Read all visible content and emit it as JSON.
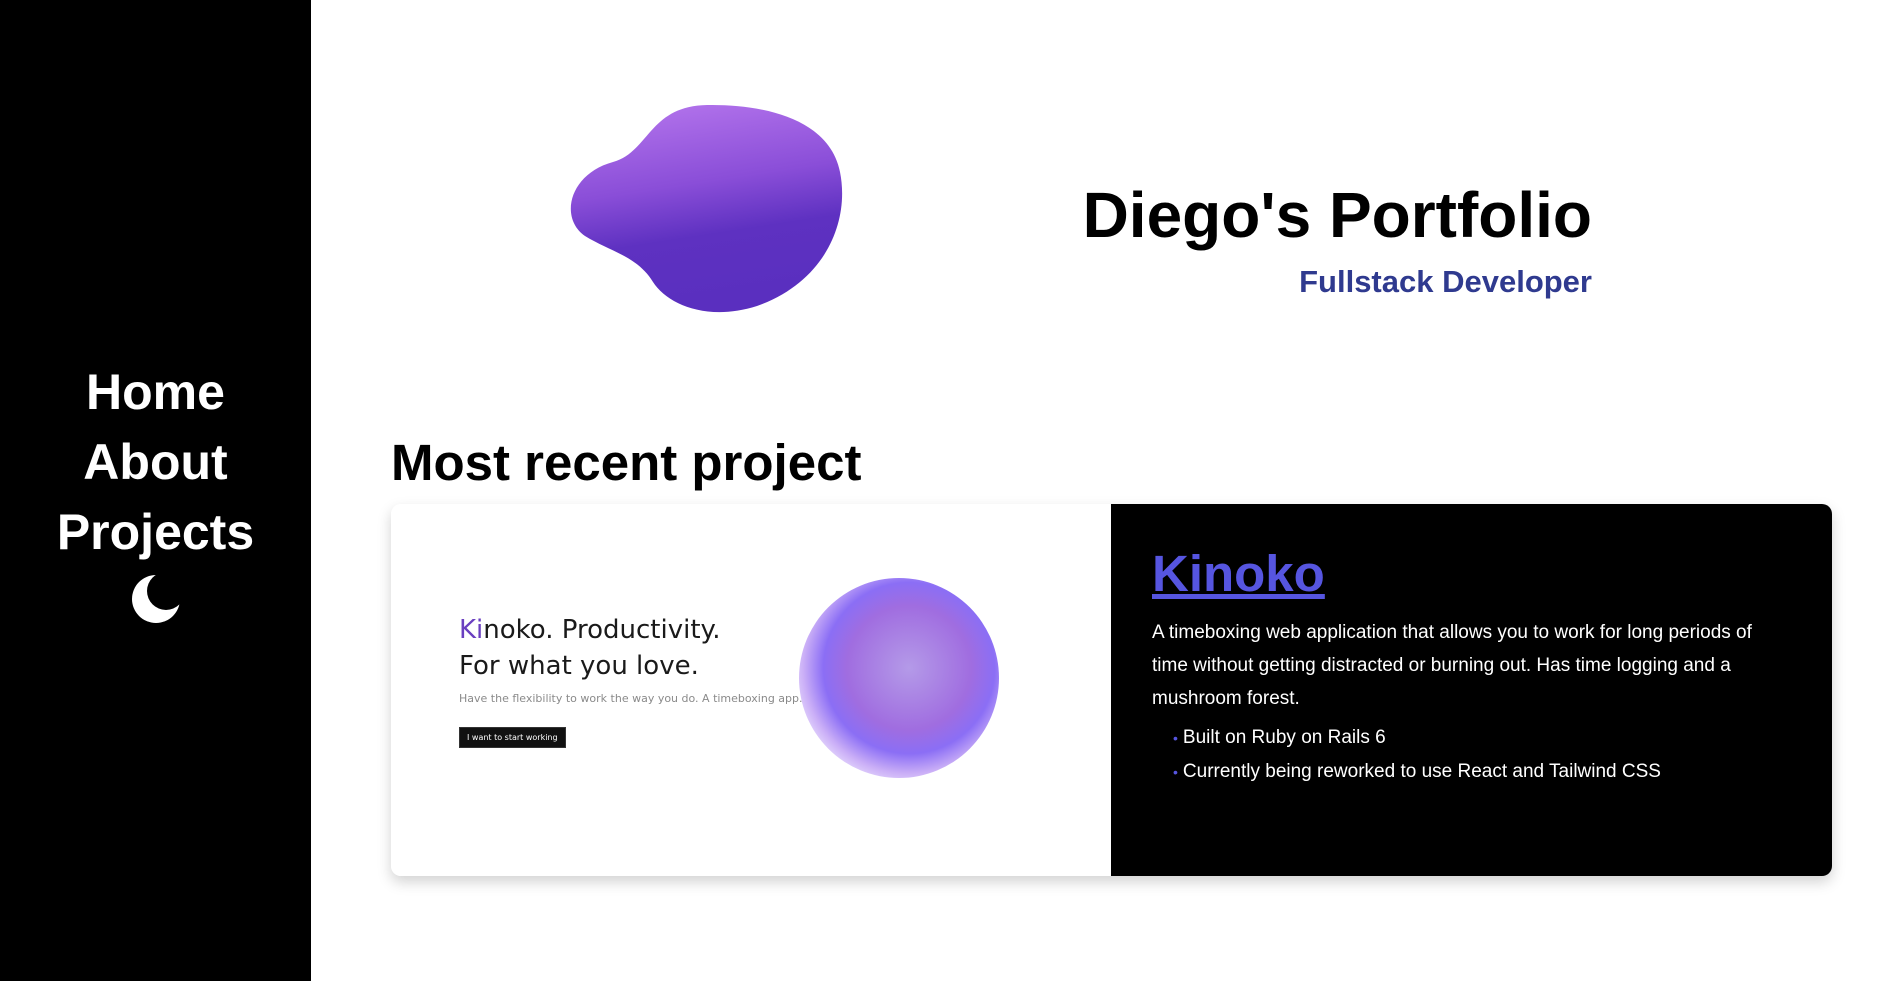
{
  "sidebar": {
    "items": [
      {
        "label": "Home"
      },
      {
        "label": "About"
      },
      {
        "label": "Projects"
      }
    ],
    "theme_toggle_icon": "moon-icon"
  },
  "hero": {
    "title": "Diego's Portfolio",
    "subtitle": "Fullstack Developer",
    "blob_icon": "purple-blob-graphic"
  },
  "recent": {
    "heading": "Most recent project",
    "project": {
      "preview": {
        "headline_accent": "Ki",
        "headline_rest": "noko. Productivity.",
        "headline_line2": "For what you love.",
        "tagline": "Have the flexibility to work the way you do. A timeboxing app.",
        "button_label": "I want to start working"
      },
      "name": "Kinoko",
      "description": "A timeboxing web application that allows you to work for long periods of time without getting distracted or burning out. Has time logging and a mushroom forest.",
      "features": [
        "Built on Ruby on Rails 6",
        "Currently being reworked to use React and Tailwind CSS"
      ]
    }
  },
  "colors": {
    "sidebar_bg": "#000000",
    "subtitle": "#2f3a8f",
    "link_accent": "#5655e0",
    "blob_light": "#b06ee8",
    "blob_dark": "#5a2fbf"
  }
}
